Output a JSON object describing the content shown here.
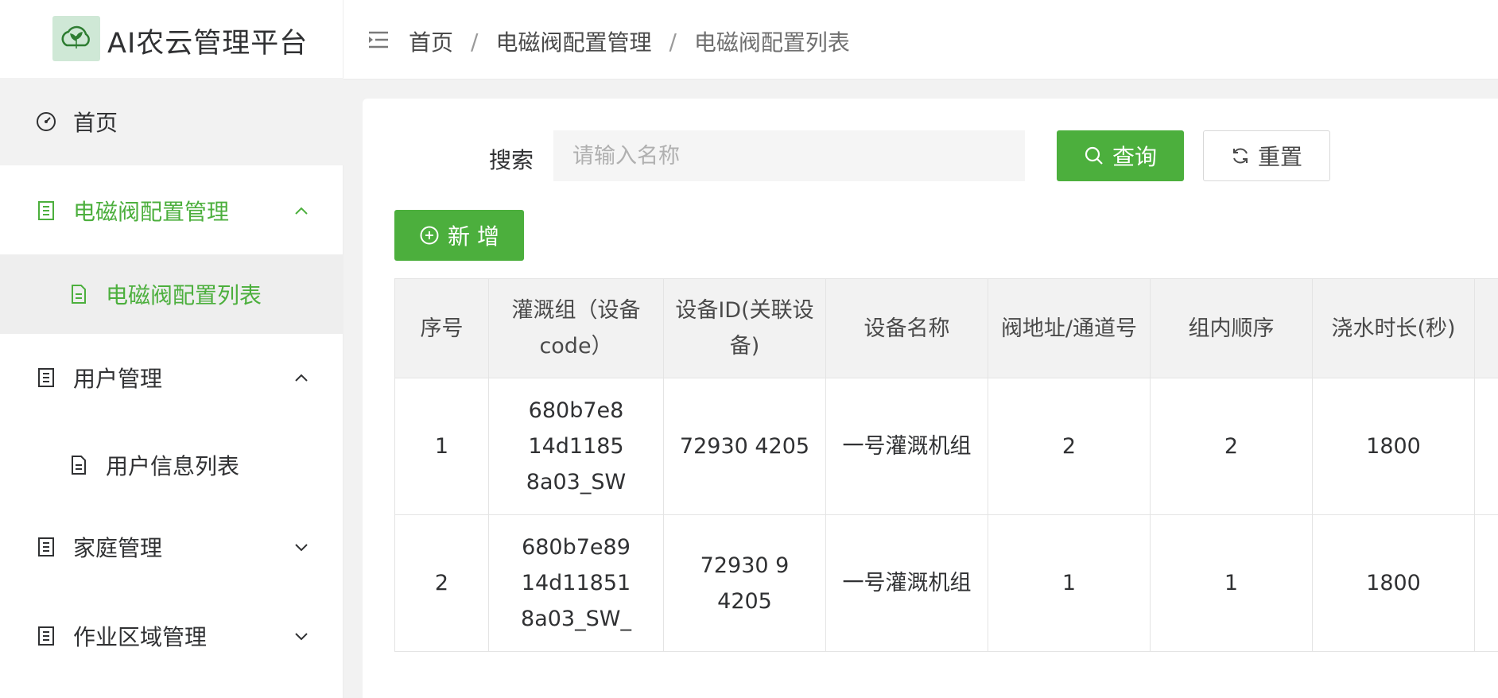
{
  "app": {
    "title": "AI农云管理平台"
  },
  "sidebar": {
    "items": [
      {
        "label": "首页",
        "icon": "dashboard-icon"
      },
      {
        "label": "电磁阀配置管理",
        "icon": "list-icon",
        "expanded": true,
        "children": [
          {
            "label": "电磁阀配置列表",
            "icon": "document-icon",
            "active": true
          }
        ]
      },
      {
        "label": "用户管理",
        "icon": "list-icon",
        "expanded": true,
        "children": [
          {
            "label": "用户信息列表",
            "icon": "document-icon"
          }
        ]
      },
      {
        "label": "家庭管理",
        "icon": "list-icon",
        "expanded": false
      },
      {
        "label": "作业区域管理",
        "icon": "list-icon",
        "expanded": false
      }
    ]
  },
  "breadcrumb": [
    "首页",
    "电磁阀配置管理",
    "电磁阀配置列表"
  ],
  "search": {
    "label": "搜索",
    "placeholder": "请输入名称",
    "value": ""
  },
  "buttons": {
    "query": "查询",
    "reset": "重置",
    "add": "新 增"
  },
  "table": {
    "headers": [
      "序号",
      "灌溉组（设备code）",
      "设备ID(关联设备)",
      "设备名称",
      "阀地址/通道号",
      "组内顺序",
      "浇水时长(秒)"
    ],
    "rows": [
      {
        "index": "1",
        "group_code": "680b7e8 14d1185 8a03_SW",
        "device_id": "72930 4205",
        "device_name": "一号灌溉机组",
        "address": "2",
        "order": "2",
        "duration": "1800"
      },
      {
        "index": "2",
        "group_code": "680b7e89 14d11851 8a03_SW_",
        "device_id": "72930 9 4205",
        "device_name": "一号灌溉机组",
        "address": "1",
        "order": "1",
        "duration": "1800"
      }
    ]
  },
  "colors": {
    "accent": "#4caf3d"
  }
}
